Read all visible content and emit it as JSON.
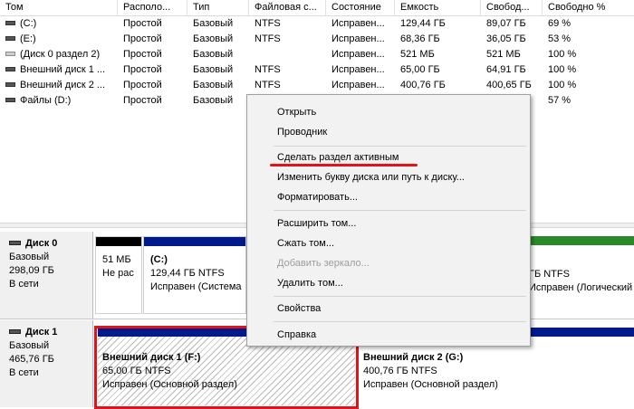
{
  "table": {
    "columns": [
      "Том",
      "Располо...",
      "Тип",
      "Файловая с...",
      "Состояние",
      "Емкость",
      "Свобод...",
      "Свободно %"
    ],
    "rows": [
      {
        "name": "(C:)",
        "layout": "Простой",
        "type": "Базовый",
        "fs": "NTFS",
        "status": "Исправен...",
        "capacity": "129,44 ГБ",
        "free": "89,07 ГБ",
        "free_pct": "69 %",
        "icon": "volume-icon"
      },
      {
        "name": "(E:)",
        "layout": "Простой",
        "type": "Базовый",
        "fs": "NTFS",
        "status": "Исправен...",
        "capacity": "68,36 ГБ",
        "free": "36,05 ГБ",
        "free_pct": "53 %",
        "icon": "volume-icon"
      },
      {
        "name": "(Диск 0 раздел 2)",
        "layout": "Простой",
        "type": "Базовый",
        "fs": "",
        "status": "Исправен...",
        "capacity": "521 МБ",
        "free": "521 МБ",
        "free_pct": "100 %",
        "icon": "volume-icon"
      },
      {
        "name": "Внешний диск 1 ...",
        "layout": "Простой",
        "type": "Базовый",
        "fs": "NTFS",
        "status": "Исправен...",
        "capacity": "65,00 ГБ",
        "free": "64,91 ГБ",
        "free_pct": "100 %",
        "icon": "volume-icon"
      },
      {
        "name": "Внешний диск 2 ...",
        "layout": "Простой",
        "type": "Базовый",
        "fs": "NTFS",
        "status": "Исправен...",
        "capacity": "400,76 ГБ",
        "free": "400,65 ГБ",
        "free_pct": "100 %",
        "icon": "volume-icon"
      },
      {
        "name": "Файлы (D:)",
        "layout": "Простой",
        "type": "Базовый",
        "fs": "",
        "status": "",
        "capacity": "",
        "free": "",
        "free_pct": "57 %",
        "icon": "volume-icon"
      }
    ]
  },
  "disks": [
    {
      "name": "Диск 0",
      "type": "Базовый",
      "size": "298,09 ГБ",
      "status": "В сети",
      "partitions": [
        {
          "line1": "",
          "line2": "51 МБ",
          "line3": "Не рас"
        },
        {
          "line1": "(C:)",
          "line2": "129,44 ГБ NTFS",
          "line3": "Исправен (Система"
        },
        {
          "line1": "",
          "line2": "ГБ NTFS",
          "line3": "Исправен (Логический ."
        }
      ]
    },
    {
      "name": "Диск 1",
      "type": "Базовый",
      "size": "465,76 ГБ",
      "status": "В сети",
      "partitions": [
        {
          "line1": "Внешний диск 1  (F:)",
          "line2": "65,00 ГБ NTFS",
          "line3": "Исправен (Основной раздел)"
        },
        {
          "line1": "Внешний диск 2  (G:)",
          "line2": "400,76 ГБ NTFS",
          "line3": "Исправен (Основной раздел)"
        }
      ]
    }
  ],
  "context_menu": {
    "items": [
      {
        "label": "Открыть",
        "enabled": true
      },
      {
        "label": "Проводник",
        "enabled": true
      },
      {
        "label": "Сделать раздел активным",
        "enabled": true
      },
      {
        "label": "Изменить букву диска или путь к диску...",
        "enabled": true
      },
      {
        "label": "Форматировать...",
        "enabled": true
      },
      {
        "label": "Расширить том...",
        "enabled": true
      },
      {
        "label": "Сжать том...",
        "enabled": true
      },
      {
        "label": "Добавить зеркало...",
        "enabled": false
      },
      {
        "label": "Удалить том...",
        "enabled": true
      },
      {
        "label": "Свойства",
        "enabled": true
      },
      {
        "label": "Справка",
        "enabled": true
      }
    ]
  },
  "colors": {
    "highlight": "#e0131b",
    "primary_partition_bar": "#001a8c",
    "unallocated_bar": "#000000",
    "logical_bar": "#2a8a2a"
  }
}
